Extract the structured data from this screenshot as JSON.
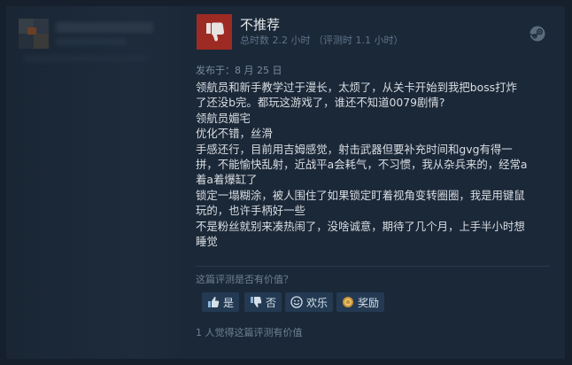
{
  "review": {
    "verdict": "不推荐",
    "hours": "总时数 2.2 小时 （评测时 1.1 小时）",
    "posted": "发布于：8 月 25 日",
    "lines": [
      "领航员和新手教学过于漫长，太烦了，从关卡开始到我把boss打炸",
      "了还没b完。都玩这游戏了，谁还不知道0079剧情?",
      "领航员媚宅",
      "优化不错，丝滑",
      "手感还行，目前用吉姆感觉，射击武器但要补充时间和gvg有得一",
      "拼，不能愉快乱射，近战平a会耗气，不习惯，我从杂兵来的，经常a",
      "着a着爆缸了",
      "锁定一塌糊涂，被人围住了如果锁定盯着视角变转圈圈，我是用键鼠",
      "玩的，也许手柄好一些",
      "不是粉丝就别来凑热闹了，没啥诚意，期待了几个月，上手半小时想",
      "睡觉"
    ],
    "icon": "thumbs-down-icon",
    "verdict_color": "#9e2b23"
  },
  "helpful": {
    "question": "这篇评测是否有价值？",
    "yes_label": "是",
    "no_label": "否",
    "funny_label": "欢乐",
    "award_label": "奖励",
    "count_text": "1 人觉得这篇评测有价值"
  },
  "colors": {
    "background": "#16202d",
    "card": "#1b2838",
    "button": "#233a52"
  }
}
